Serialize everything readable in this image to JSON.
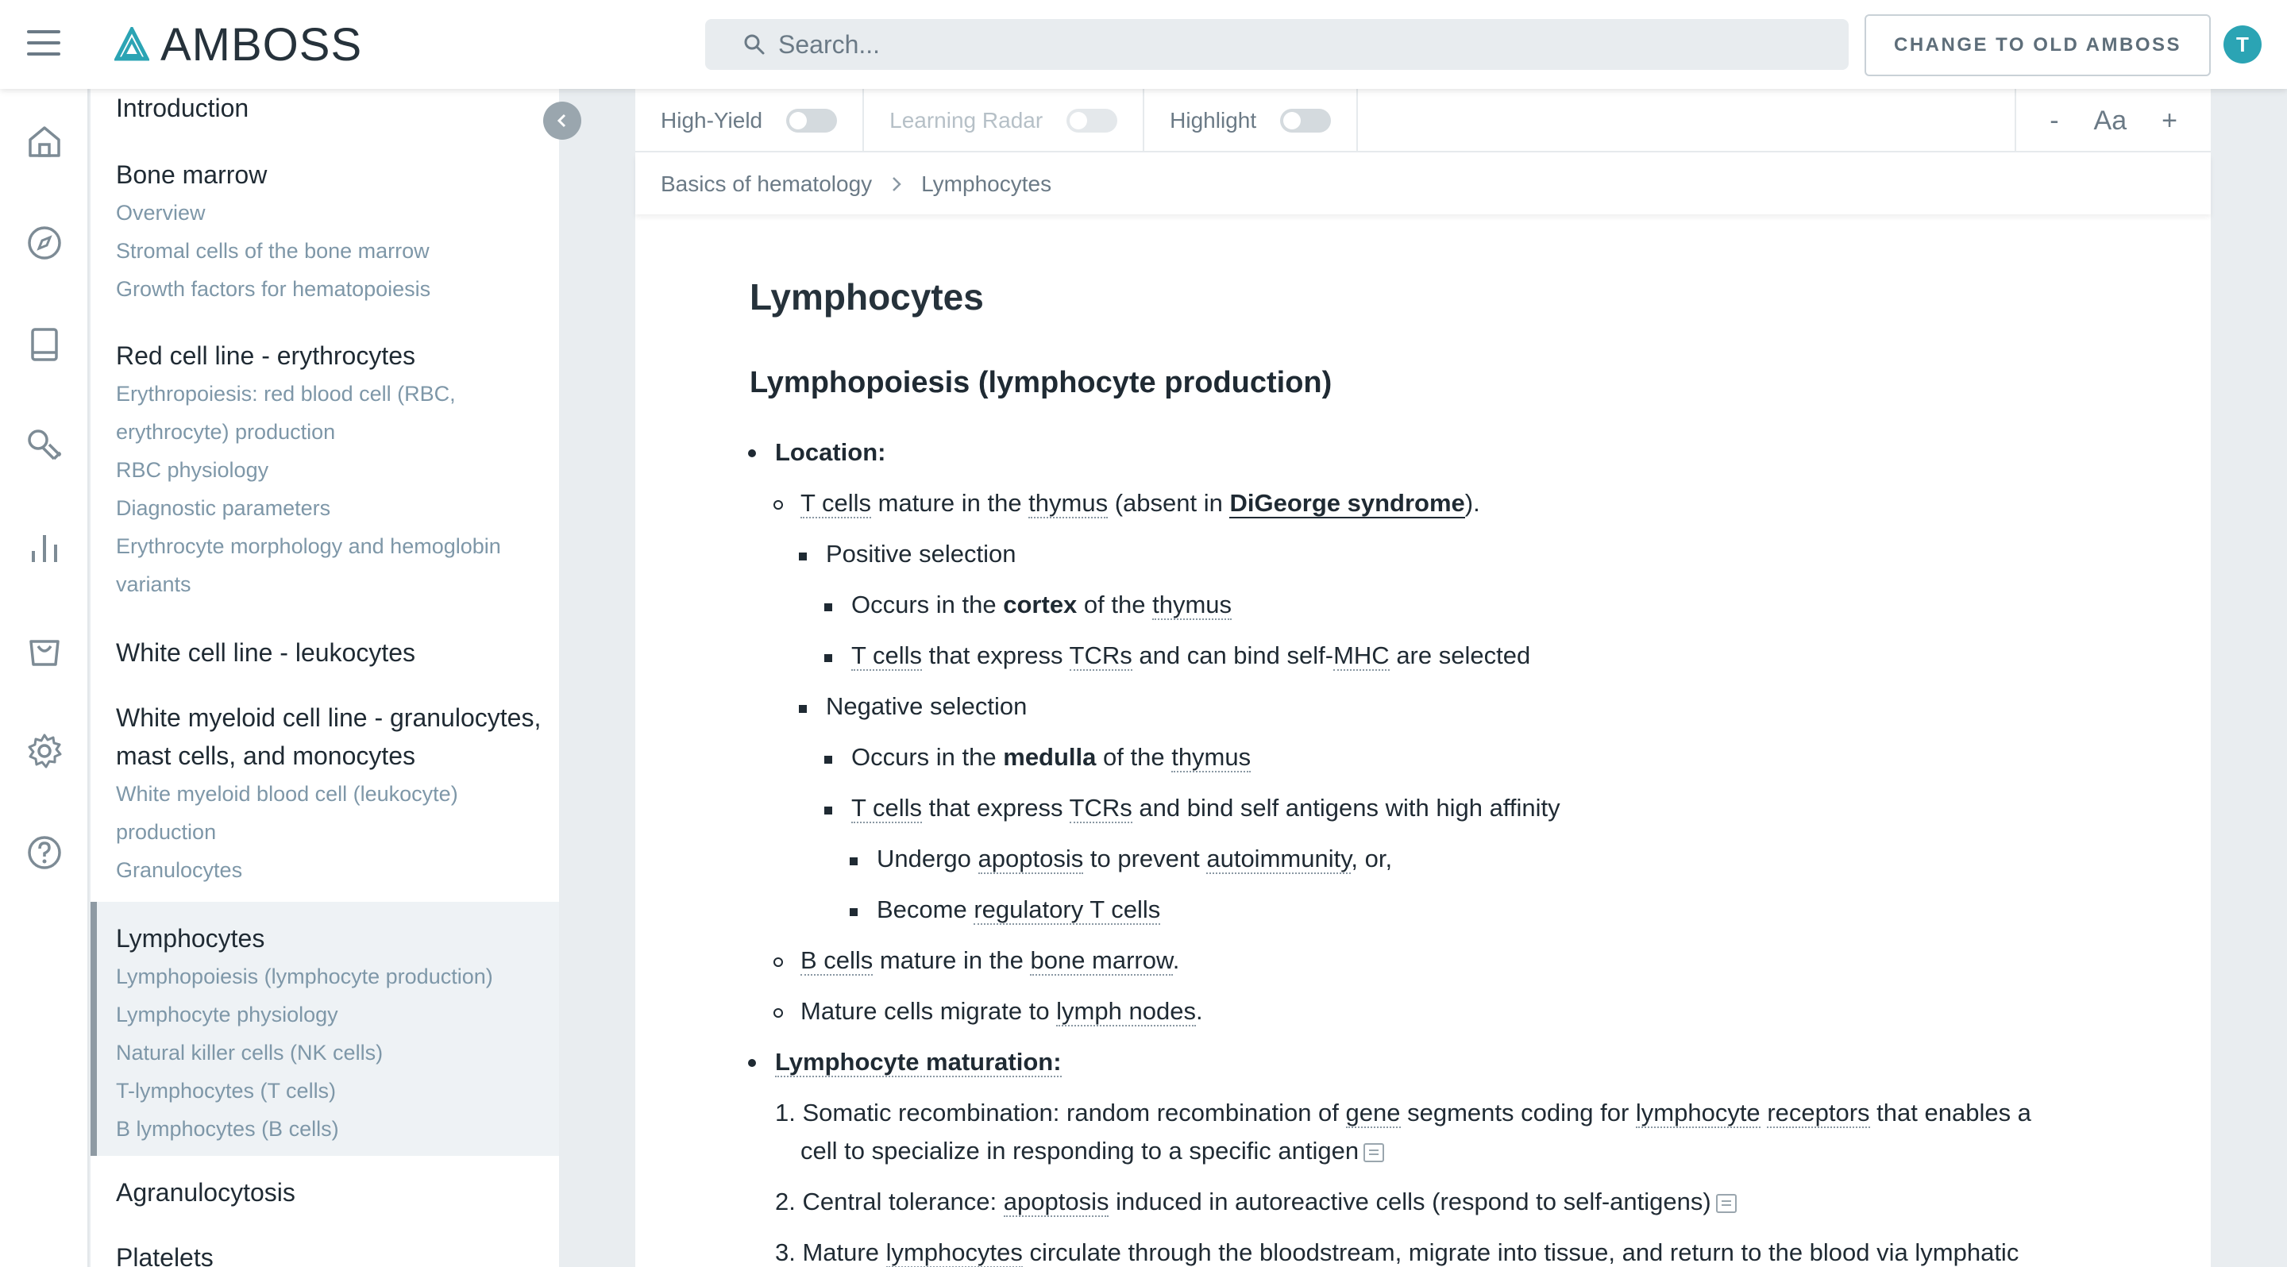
{
  "topbar": {
    "logo_text": "AMBOSS",
    "search_placeholder": "Search...",
    "old_button": "CHANGE TO OLD AMBOSS",
    "avatar_initial": "T"
  },
  "rail_icons": [
    "home-icon",
    "compass-icon",
    "book-icon",
    "stethoscope-icon",
    "bar-chart-icon",
    "shopping-bag-icon",
    "gear-icon",
    "help-icon"
  ],
  "toc": {
    "intro": "Introduction",
    "sections": [
      {
        "title": "Bone marrow",
        "items": [
          "Overview",
          "Stromal cells of the bone marrow",
          "Growth factors for hematopoiesis"
        ]
      },
      {
        "title": "Red cell line - erythrocytes",
        "items": [
          "Erythropoiesis: red blood cell (RBC,",
          "erythrocyte) production",
          "RBC physiology",
          "Diagnostic parameters",
          "Erythrocyte morphology and hemoglobin",
          "variants"
        ]
      },
      {
        "title": "White cell line - leukocytes",
        "items": []
      },
      {
        "title_lines": [
          "White myeloid cell line - granulocytes,",
          "mast cells, and monocytes"
        ],
        "items": [
          "White myeloid blood cell (leukocyte)",
          "production",
          "Granulocytes"
        ]
      },
      {
        "title": "Lymphocytes",
        "items": [
          "Lymphopoiesis (lymphocyte production)",
          "Lymphocyte physiology",
          "Natural killer cells (NK cells)",
          "T-lymphocytes (T cells)",
          "B lymphocytes (B cells)"
        ]
      },
      {
        "title": "Agranulocytosis",
        "items": []
      },
      {
        "title": "Platelets",
        "items": []
      }
    ]
  },
  "toolbar": {
    "high_yield": "High-Yield",
    "learning_radar": "Learning Radar",
    "highlight": "Highlight",
    "font_minus": "-",
    "font_label": "Aa",
    "font_plus": "+"
  },
  "breadcrumb": {
    "parent": "Basics of hematology",
    "current": "Lymphocytes"
  },
  "article": {
    "title": "Lymphocytes",
    "section": "Lymphopoiesis (lymphocyte production)",
    "location_label": "Location:",
    "t1a": "T cells",
    "t1b": " mature in the ",
    "t1c": "thymus",
    "t1d": " (absent in ",
    "t1e": "DiGeorge syndrome",
    "t1f": ").",
    "positive": "Positive selection",
    "pos1a": "Occurs in the ",
    "pos1b": "cortex",
    "pos1c": " of the ",
    "pos1d": "thymus",
    "pos2a": "T cells",
    "pos2b": " that express ",
    "pos2c": "TCRs",
    "pos2d": " and can bind self-",
    "pos2e": "MHC",
    "pos2f": " are selected",
    "negative": "Negative selection",
    "neg1a": "Occurs in the ",
    "neg1b": "medulla",
    "neg1c": " of the ",
    "neg1d": "thymus",
    "neg2a": "T cells",
    "neg2b": " that express ",
    "neg2c": "TCRs",
    "neg2d": " and bind self antigens with high affinity",
    "und1a": "Undergo ",
    "und1b": "apoptosis",
    "und1c": " to prevent ",
    "und1d": "autoimmunity",
    "und1e": ", or,",
    "und2a": "Become ",
    "und2b": "regulatory T cells",
    "b1a": "B cells",
    "b1b": " mature in the ",
    "b1c": "bone marrow",
    "b1d": ".",
    "m1a": "Mature cells migrate to ",
    "m1b": "lymph nodes",
    "m1c": ".",
    "maturation_label": "Lymphocyte maturation:",
    "n1a": "1. Somatic recombination: random recombination of ",
    "n1b": "gene",
    "n1c": " segments coding for ",
    "n1d": "lymphocyte",
    "n1e": " ",
    "n1f": "receptors",
    "n1g": " that enables a",
    "n1h": "cell to specialize in responding to a specific antigen",
    "n2a": "2. Central tolerance: ",
    "n2b": "apoptosis",
    "n2c": " induced in autoreactive cells (respond to self-antigens)",
    "n3a": "3. Mature ",
    "n3b": "lymphocytes",
    "n3c": " circulate through the bloodstream, migrate into tissue, and return to the blood via lymphatic"
  }
}
